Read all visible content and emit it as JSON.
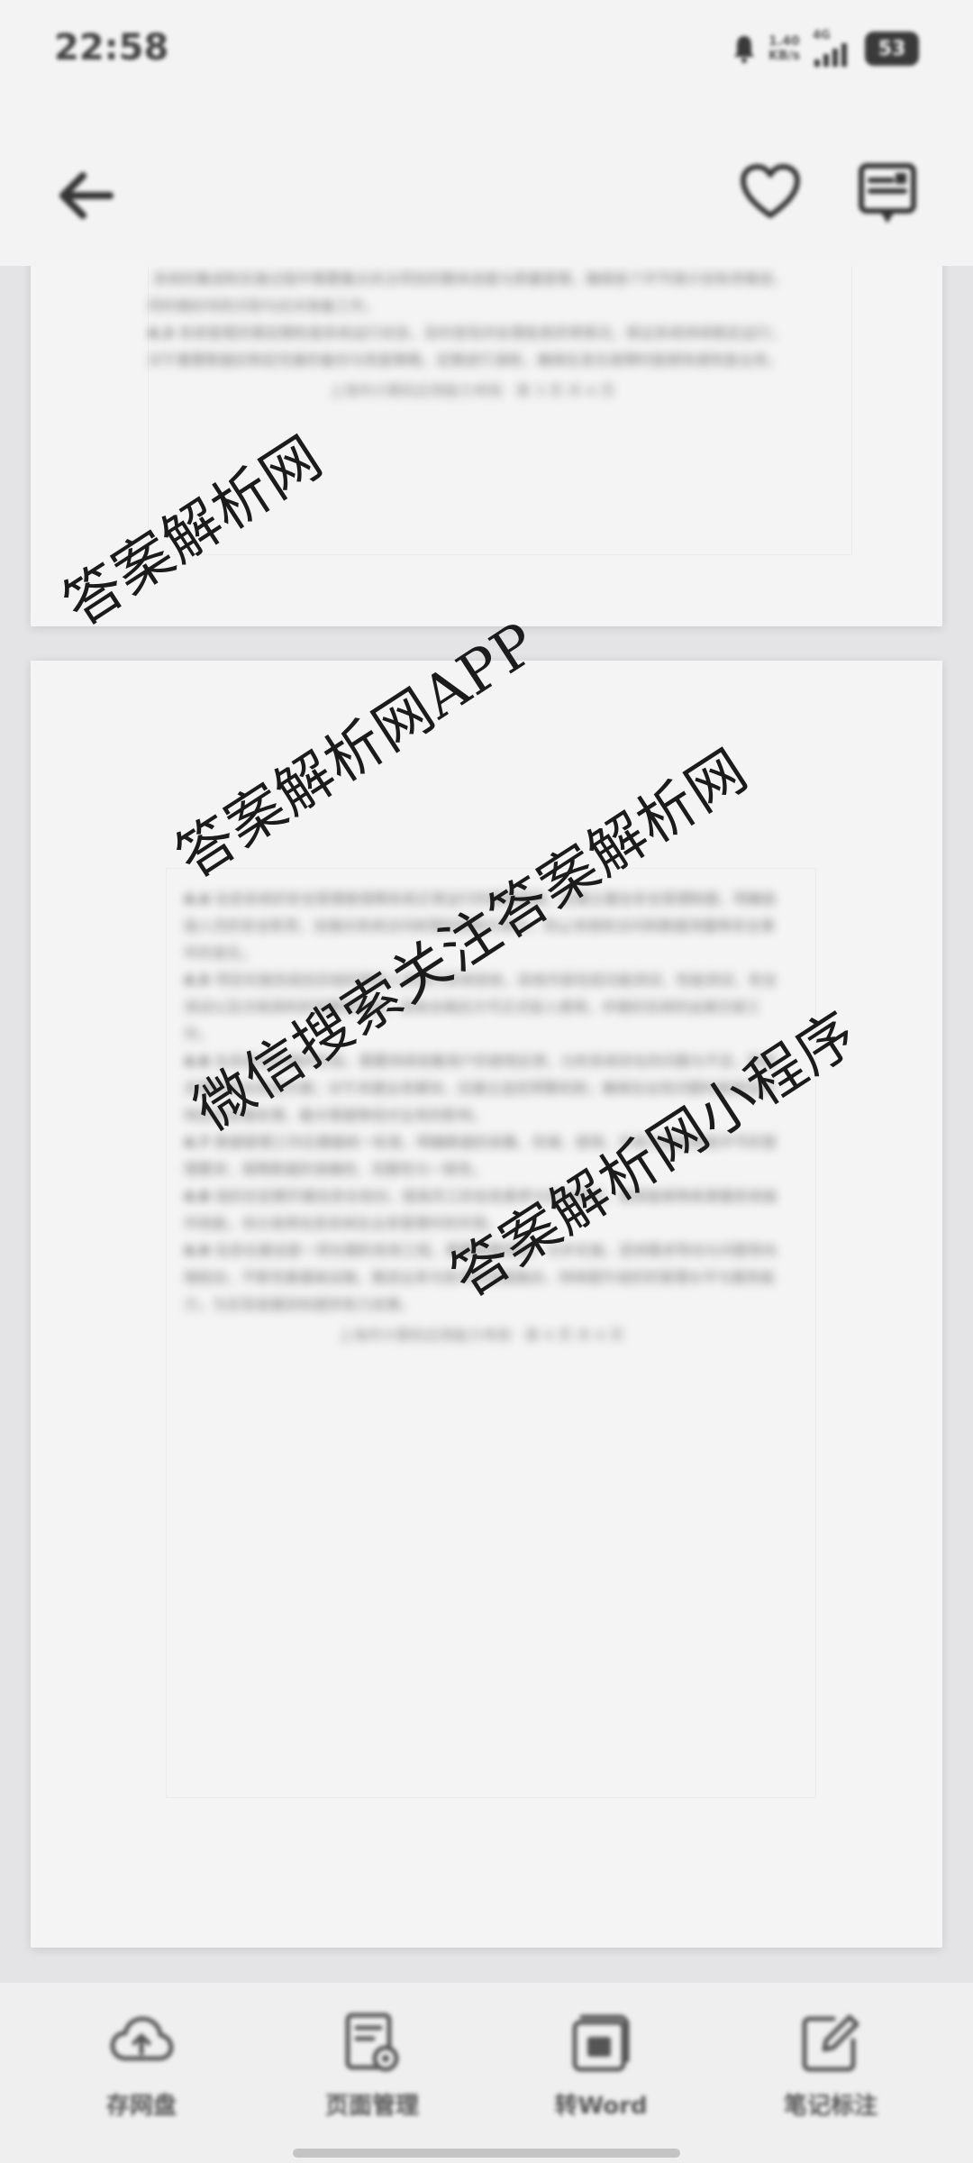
{
  "status_bar": {
    "time": "22:58",
    "net_speed_value": "1.40",
    "net_speed_unit": "KB/s",
    "network_type": "4G",
    "battery": "53",
    "icons": [
      "alarm-icon",
      "signal-icon"
    ]
  },
  "top_bar": {
    "icons": [
      "back-arrow-icon",
      "heart-icon",
      "document-icon"
    ]
  },
  "document": {
    "page_1": {
      "paragraphs": [
        {
          "num": "",
          "text": "系统的集成和实施过程中需要重点关注项目的整体进度与质量管理，确保各个环节按计划有序推进，同时做好风险识别与应对准备工作。"
        },
        {
          "num": "4.3",
          "text": "系统管理员需定期检查系统运行状态，及时发现并处理各类异常情况，保证系统持续稳定运行；对于重要数据应制定完善的备份与恢复策略，定期进行演练，确保在发生故障时能够快速恢复业务。"
        }
      ],
      "footer": "上海市计算机应用能力考核 · 第 3 页 共 4 页"
    },
    "page_2": {
      "paragraphs": [
        {
          "num": "4.4",
          "text": "信息系统的安全管理是保障系统正常运行的重要基础，应建立健全安全管理制度，明确各级人员的安全职责，加强对系统访问权限的控制与审计，防止非授权访问和数据泄露等安全事件的发生。"
        },
        {
          "num": "4.5",
          "text": "项目实施完成后应组织相关人员进行系统验收，验收内容包括功能测试、性能测试、安全测试以及文档资料的完整性检查，验收合格后方可正式投入使用，并做好后续的运维交接工作。"
        },
        {
          "num": "4.6",
          "text": "在系统运行维护阶段，需要持续收集用户的使用反馈，分析系统存在的问题与不足，制定合理的优化改进方案；对于关键业务模块，应建立监控预警机制，确保在出现问题时能够及时响应并妥善处理，最大限度降低对业务的影响。"
        },
        {
          "num": "4.7",
          "text": "数据管理工作应遵循统一标准，明确数据的采集、存储、使用、共享与销毁等各环节的管理要求，保障数据的准确性、完整性与一致性。"
        },
        {
          "num": "4.8",
          "text": "组织应定期开展信息化培训，提高员工的信息素养与安全意识，使其能够熟练掌握系统操作技能，充分发挥信息系统在业务管理中的作用。"
        },
        {
          "num": "4.9",
          "text": "信息化建设是一项长期的系统工程，需要统筹规划、分步实施，坚持需求导向与问题导向相结合，不断完善基础设施，推进业务与技术的深度融合，持续提升组织的管理水平与服务能力，为实现发展目标提供有力支撑。"
        }
      ],
      "footer": "上海市计算机应用能力考核 · 第 4 页 共 4 页"
    },
    "watermarks": [
      "答案解析网",
      "答案解析网APP",
      "微信搜索关注答案解析网",
      "答案解析网小程序"
    ]
  },
  "bottom_bar": {
    "items": [
      {
        "label": "存网盘",
        "icon": "cloud-upload-icon"
      },
      {
        "label": "页面管理",
        "icon": "page-manage-icon"
      },
      {
        "label": "转Word",
        "icon": "convert-word-icon"
      },
      {
        "label": "笔记标注",
        "icon": "note-edit-icon"
      }
    ]
  }
}
